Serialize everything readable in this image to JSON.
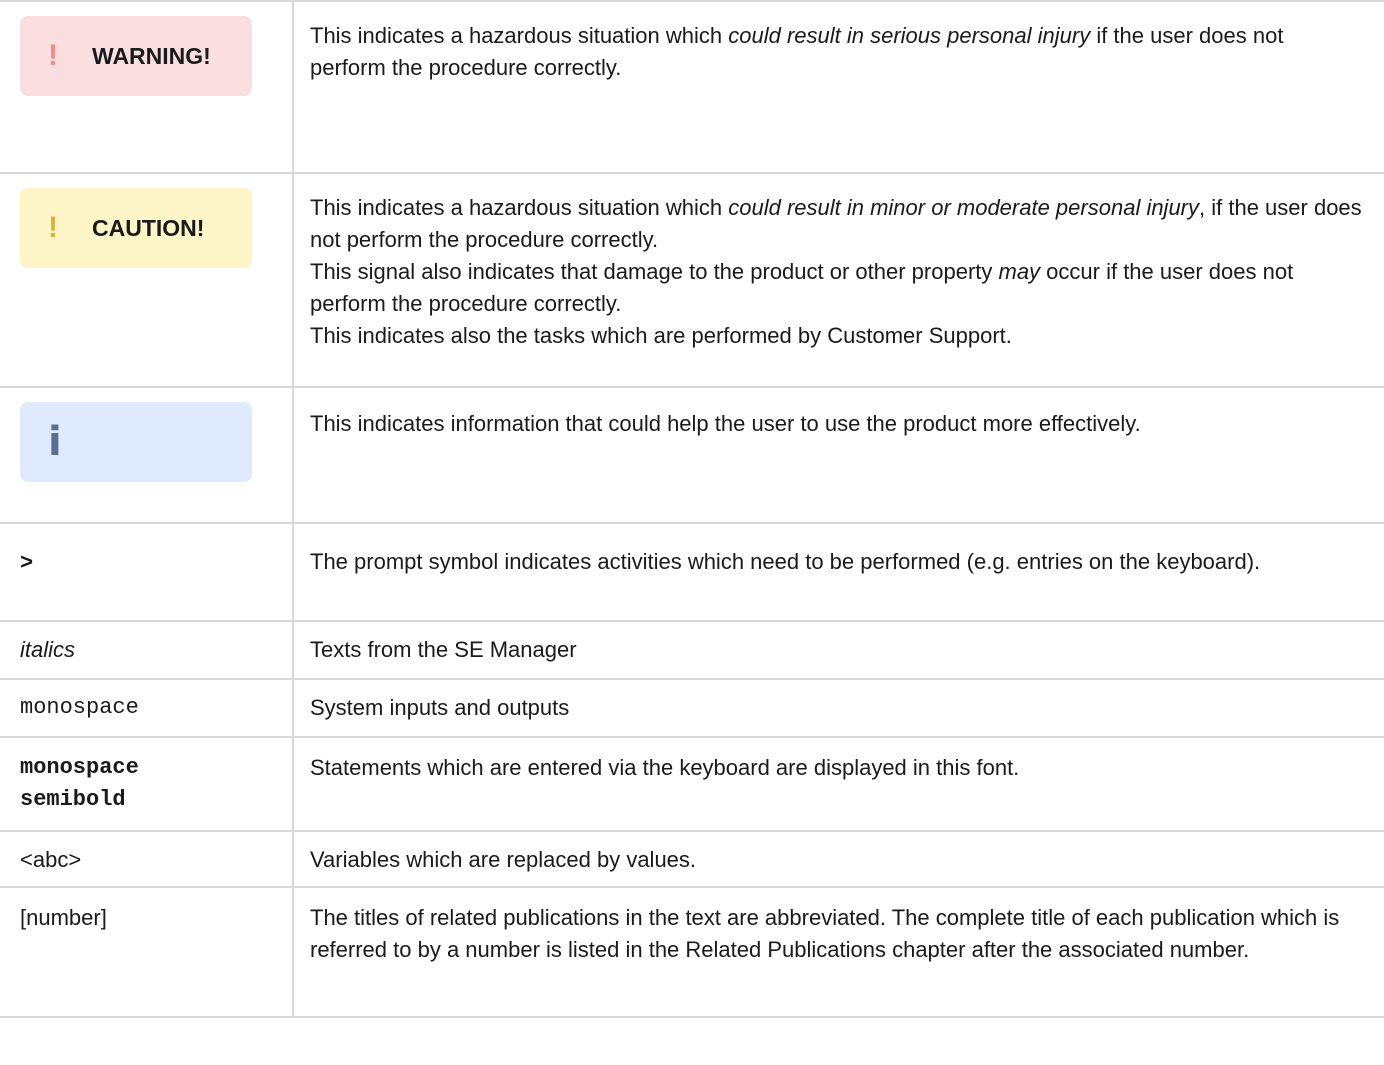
{
  "rows": [
    {
      "badge": {
        "mark": "!",
        "label": "WARNING!"
      },
      "text_parts": [
        "This indicates a hazardous situation which ",
        "could result in serious personal injury",
        " if the user does not perform the procedure correctly."
      ]
    },
    {
      "badge": {
        "mark": "!",
        "label": "CAUTION!"
      },
      "text_parts": [
        "This indicates a hazardous situation which ",
        "could result in minor or moderate personal injury",
        ", if the user does not perform the procedure correctly."
      ],
      "text2_parts": [
        "This signal also indicates that damage to the product or other property ",
        "may",
        " occur if the user does not perform the procedure correctly."
      ],
      "text3": "This indicates also the tasks which are performed by Customer Support."
    },
    {
      "badge": {
        "mark": "i",
        "label": ""
      },
      "text": "This indicates information that could help the user to use the product more effectively."
    },
    {
      "left": ">",
      "text": "The prompt symbol indicates activities which need to be performed (e.g. entries on the keyboard)."
    },
    {
      "left": "italics",
      "text": "Texts from the SE Manager"
    },
    {
      "left": "monospace",
      "text": "System inputs and outputs"
    },
    {
      "left": "monospace semibold",
      "text": "Statements which are entered via the keyboard are displayed in this font."
    },
    {
      "left": "<abc>",
      "text": "Variables which are replaced by values."
    },
    {
      "left": "[number]",
      "text": "The titles of related publications in the text are abbreviated. The complete title of each publication which is referred to by a number is listed in the Related Publications chapter after the associated number."
    }
  ],
  "colors": {
    "warning_bg": "#fbdfe0",
    "warning_mark": "#f28b82",
    "caution_bg": "#fdf4c7",
    "caution_mark": "#d9b23a",
    "info_bg": "#dfebfd",
    "info_mark": "#5b6f93",
    "border": "#d8d8d8"
  }
}
